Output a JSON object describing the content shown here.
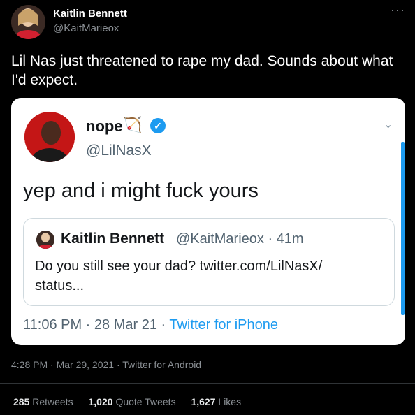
{
  "tweet": {
    "author_name": "Kaitlin Bennett",
    "author_handle": "@KaitMarieox",
    "more_label": "···",
    "text": "Lil Nas just threatened to rape my dad. Sounds about what I'd expect.",
    "timestamp": "4:28 PM · Mar 29, 2021 · Twitter for Android"
  },
  "embedded": {
    "name": "nope",
    "bow_icon": "🏹",
    "verified_glyph": "✓",
    "handle": "@LilNasX",
    "chevron": "⌄",
    "text": "yep and i might fuck yours",
    "time": "11:06 PM · 28 Mar 21 · ",
    "source": "Twitter for iPhone",
    "quoted": {
      "name": "Kaitlin Bennett",
      "handle_time": "@KaitMarieox · 41m",
      "text": "Do you still see your dad? twitter.com/LilNasX/ status..."
    }
  },
  "stats": {
    "retweets_count": "285",
    "retweets_label": "Retweets",
    "quotes_count": "1,020",
    "quotes_label": "Quote Tweets",
    "likes_count": "1,627",
    "likes_label": "Likes"
  },
  "colors": {
    "accent": "#1d9bf0",
    "background": "#000000",
    "card": "#ffffff"
  }
}
